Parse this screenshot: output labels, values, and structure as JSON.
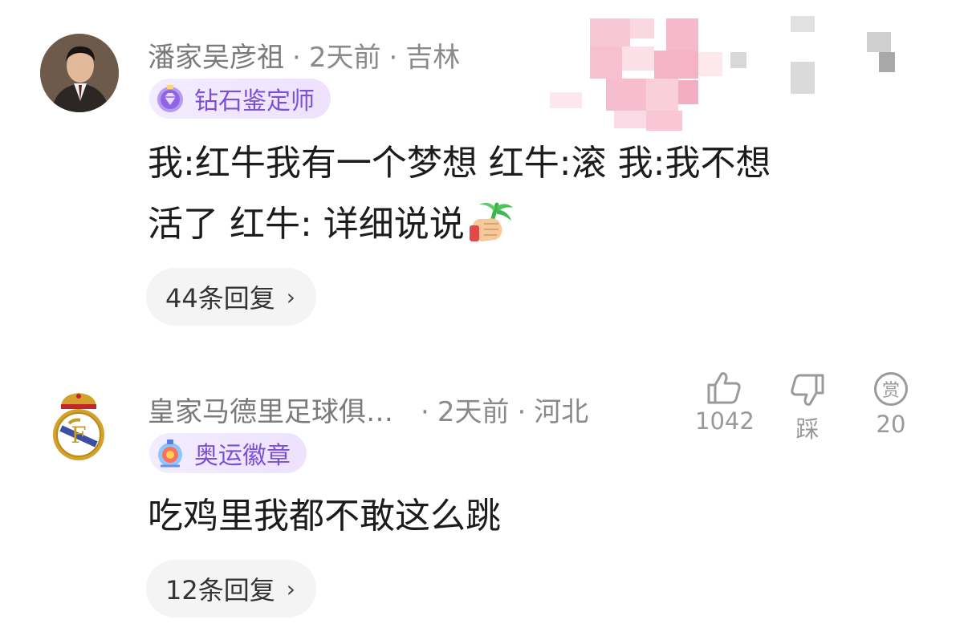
{
  "comments": [
    {
      "username": "潘家吴彦祖",
      "time": "2天前",
      "location": "吉林",
      "badge": "钻石鉴定师",
      "text_line1": "我:红牛我有一个梦想   红牛:滚         我:我不想",
      "text_line2": "活了    红牛: 详细说说",
      "replies": "44条回复"
    },
    {
      "username": "皇家马德里足球俱…",
      "time": "2天前",
      "location": "河北",
      "badge": "奥运徽章",
      "text_line1": "吃鸡里我都不敢这么跳",
      "replies": "12条回复",
      "like_count": "1042",
      "dislike_label": "踩",
      "reward_count": "20",
      "reward_glyph": "赏"
    }
  ],
  "separator": "·",
  "chevron": "›",
  "icons": {
    "like": "thumbs-up-icon",
    "dislike": "thumbs-down-icon",
    "reward": "reward-icon"
  },
  "colors": {
    "badge_text": "#7b4fd6",
    "meta_text": "#8a8a8a",
    "pill_bg": "#f4f4f4"
  }
}
